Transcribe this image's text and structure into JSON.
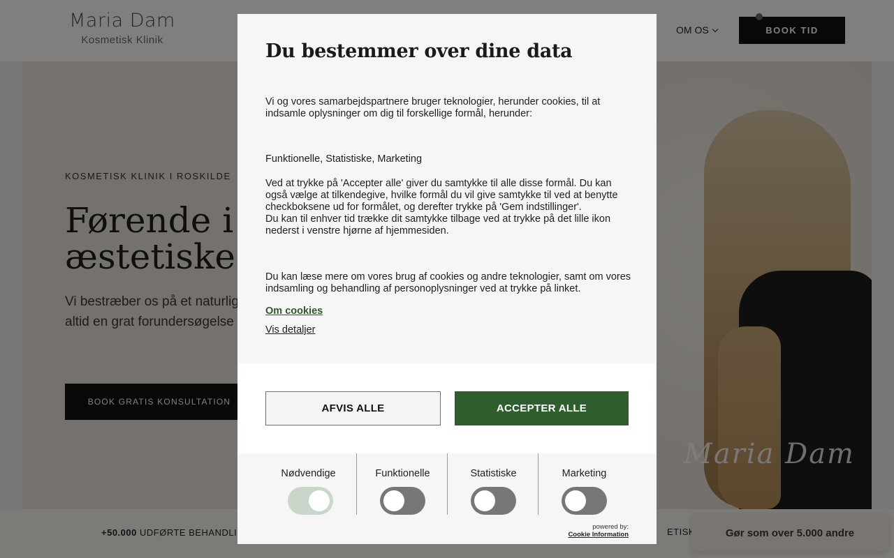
{
  "site": {
    "logo": {
      "name": "Maria Dam",
      "subtitle": "Kosmetisk Klinik"
    },
    "nav": {
      "om_os": "OM OS"
    },
    "book_button": "BOOK TID",
    "hero": {
      "kicker": "KOSMETISK KLINIK I ROSKILDE",
      "title": "Førende i n           æstetiske re",
      "text": "Vi bestræber os på et naturligt, resultat og tilbyder altid en grat forundersøgelse hos læge og s",
      "cta": "BOOK GRATIS KONSULTATION",
      "signature": "Maria Dam"
    },
    "stats": {
      "left_number": "+50.000",
      "left_text": "UDFØRTE BEHANDLING",
      "right_text": "ETISKE S"
    },
    "floating_badge": "Gør som over 5.000 andre"
  },
  "cookie_modal": {
    "title": "Du bestemmer over dine data",
    "intro": "Vi og vores samarbejdspartnere bruger teknologier, herunder cookies, til at indsamle oplysninger om dig til forskellige formål, herunder:",
    "purposes": "Funktionelle, Statistiske, Marketing",
    "consent_text_1": "Ved at trykke på 'Accepter alle' giver du samtykke til alle disse formål. Du kan også vælge at tilkendegive, hvilke formål du vil give samtykke til ved at benytte checkboksene ud for formålet, og derefter trykke på 'Gem indstillinger'.",
    "consent_text_2": "Du kan til enhver tid trække dit samtykke tilbage ved at trykke på det lille ikon nederst i venstre hjørne af hjemmesiden.",
    "more_info": "Du kan læse mere om vores brug af cookies og andre teknologier, samt om vores indsamling og behandling af personoplysninger ved at trykke på linket.",
    "link_cookies": "Om cookies",
    "link_details": "Vis detaljer",
    "reject_all": "AFVIS ALLE",
    "accept_all": "ACCEPTER ALLE",
    "categories": [
      {
        "label": "Nødvendige",
        "enabled": true,
        "locked": true
      },
      {
        "label": "Funktionelle",
        "enabled": false
      },
      {
        "label": "Statistiske",
        "enabled": false
      },
      {
        "label": "Marketing",
        "enabled": false
      }
    ],
    "powered_by": "powered by:",
    "powered_brand": "Cookie Information",
    "colors": {
      "accept": "#2e5e2d",
      "link": "#2d5a27",
      "toggle_off": "#777777",
      "toggle_on_locked": "#c8d7ca"
    }
  }
}
